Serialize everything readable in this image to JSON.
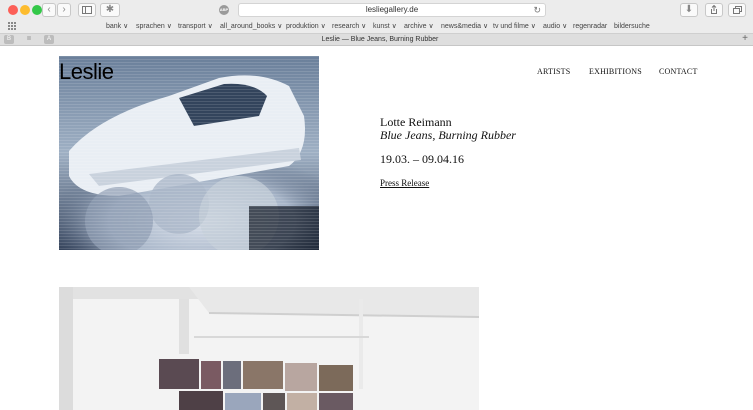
{
  "browser": {
    "url": "lesliegallery.de",
    "tab_title": "Leslie — Blue Jeans, Burning Rubber",
    "badge": "ABP",
    "tab_buttons": [
      "B",
      "A"
    ],
    "favorites": [
      "bank ∨",
      "sprachen ∨",
      "transport ∨",
      "all_around_books ∨",
      "produktion ∨",
      "research ∨",
      "kunst ∨",
      "archive ∨",
      "news&media ∨",
      "tv und filme ∨",
      "audio ∨",
      "regenradar",
      "bildersuche"
    ],
    "colors": {
      "close": "#fc5f57",
      "minimize": "#fdbc2e",
      "zoom": "#33c848"
    }
  },
  "site": {
    "logo": "Leslie",
    "nav": [
      "ARTISTS",
      "EXHIBITIONS",
      "CONTACT"
    ]
  },
  "exhibition": {
    "artist": "Lotte Reimann",
    "title": "Blue Jeans, Burning Rubber",
    "dates": "19.03. – 09.04.16",
    "press_release": "Press Release"
  }
}
